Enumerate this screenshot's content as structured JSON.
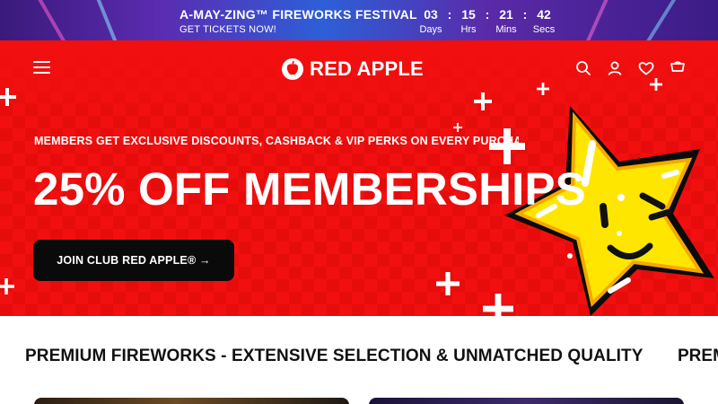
{
  "promo": {
    "title": "A-MAY-ZING™ FIREWORKS FESTIVAL",
    "cta": "GET TICKETS NOW!",
    "countdown": [
      {
        "value": "03",
        "label": "Days"
      },
      {
        "value": "15",
        "label": "Hrs"
      },
      {
        "value": "21",
        "label": "Mins"
      },
      {
        "value": "42",
        "label": "Secs"
      }
    ],
    "separator": ":"
  },
  "header": {
    "brand": "RED APPLE",
    "icons": [
      "menu-icon",
      "search-icon",
      "account-icon",
      "wishlist-heart-icon",
      "cart-icon"
    ]
  },
  "hero": {
    "subtitle": "MEMBERS GET EXCLUSIVE DISCOUNTS, CASHBACK & VIP PERKS ON EVERY PURCHASE",
    "title": "25% OFF MEMBERSHIPS",
    "cta_label": "JOIN CLUB RED APPLE® →",
    "illustration": "yellow-star-mascot"
  },
  "section": {
    "title": "PREMIUM FIREWORKS - EXTENSIVE SELECTION & UNMATCHED QUALITY",
    "next_title_fragment": "PREM"
  },
  "colors": {
    "brand_red": "#f20f0f",
    "cta_black": "#0a0a0a",
    "star_yellow": "#ffe600",
    "text_dark": "#111111"
  }
}
